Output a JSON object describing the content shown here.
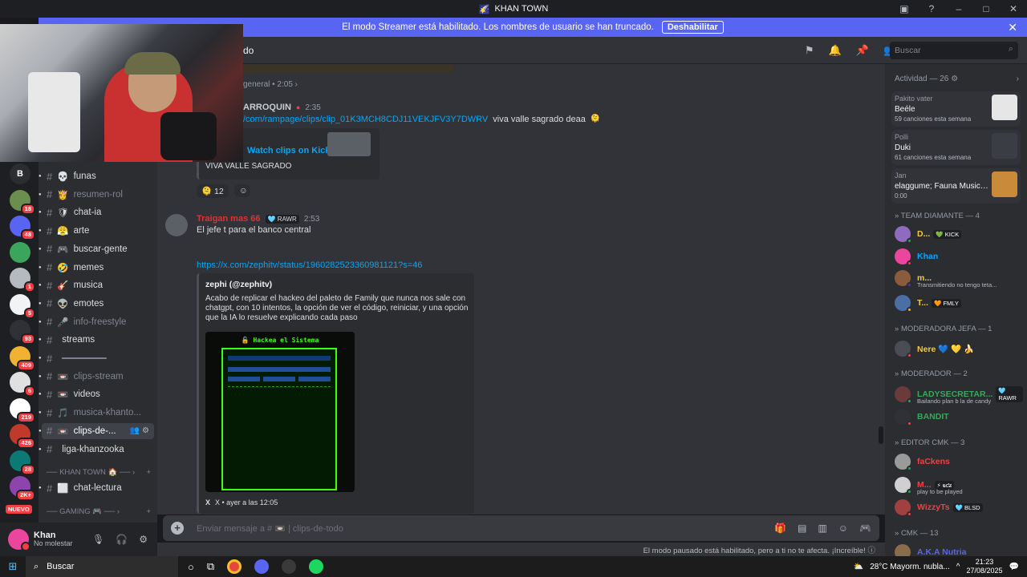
{
  "window": {
    "title": "KHAN TOWN"
  },
  "banner": {
    "text": "El modo Streamer está habilitado. Los nombres de usuario se han truncado.",
    "button": "Deshabilitar"
  },
  "header": {
    "channel_title": "do",
    "search_placeholder": "Buscar"
  },
  "servers": [
    {
      "label": "B",
      "badge": ""
    },
    {
      "label": "",
      "badge": "18"
    },
    {
      "label": "",
      "badge": "48"
    },
    {
      "label": "",
      "badge": ""
    },
    {
      "label": "",
      "badge": "1"
    },
    {
      "label": "",
      "badge": "5"
    },
    {
      "label": "",
      "badge": "93"
    },
    {
      "label": "",
      "badge": "409"
    },
    {
      "label": "",
      "badge": "6"
    },
    {
      "label": "",
      "badge": "219"
    },
    {
      "label": "",
      "badge": "426"
    },
    {
      "label": "",
      "badge": "28"
    },
    {
      "label": "",
      "badge": "2K+"
    }
  ],
  "servers_new_label": "NUEVO",
  "channels": [
    {
      "icon": "💀",
      "name": "funas",
      "muted": false
    },
    {
      "icon": "👸",
      "name": "resumen-rol",
      "muted": true
    },
    {
      "icon": "🛡",
      "name": "chat-ia",
      "muted": false
    },
    {
      "icon": "😤",
      "name": "arte",
      "muted": false
    },
    {
      "icon": "🎮",
      "name": "buscar-gente",
      "muted": false
    },
    {
      "icon": "🤣",
      "name": "memes",
      "muted": false
    },
    {
      "icon": "🎸",
      "name": "musica",
      "muted": false
    },
    {
      "icon": "👽",
      "name": "emotes",
      "muted": false
    },
    {
      "icon": "🎤",
      "name": "info-freestyle",
      "muted": true
    },
    {
      "icon": "",
      "name": "streams",
      "muted": false
    },
    {
      "icon": "",
      "name": "━━━━━━━━",
      "muted": true
    },
    {
      "icon": "📼",
      "name": "clips-stream",
      "muted": true
    },
    {
      "icon": "📼",
      "name": "videos",
      "muted": false
    },
    {
      "icon": "🎵",
      "name": "musica-khanto...",
      "muted": true
    },
    {
      "icon": "📼",
      "name": "clips-de-...",
      "muted": false
    },
    {
      "icon": "",
      "name": "liga-khanzooka",
      "muted": false
    }
  ],
  "categories": [
    {
      "name": "── KHAN TOWN 🏠 ── ›"
    },
    {
      "name": "── GAMING 🎮 ── ›"
    }
  ],
  "channel_after_cat": {
    "icon": "⬜",
    "name": "chat-lectura"
  },
  "user": {
    "name": "Khan",
    "status": "No molestar"
  },
  "messages": {
    "reply_context": "general • 2:05 ›",
    "m1_author": "ARROQUIN",
    "m1_time": "2:35",
    "m1_link": "/com/rampage/clips/clip_01K3MCH8CDJ11VEKJFV3Y7DWRV",
    "m1_text": "viva valle sagrado deaa",
    "m1_embed_title": "Watch clips on Kick",
    "m1_embed_text": "VIVA VALLE SAGRADO",
    "m1_reaction_count": "12",
    "m2_author": "Traigan mas 66",
    "m2_tag": "RAWR",
    "m2_time": "2:53",
    "m2_text": "El jefe t para el banco central",
    "m2_link": "https://x.com/zephitv/status/1960282523360981121?s=46",
    "embed_author": "zephi (@zephitv)",
    "embed_text": "Acabo de replicar el hackeo del paleto de Family que nunca nos sale con chatgpt, con 10 intentos, la opción de ver el código, reiniciar, y una opción que la IA lo resuelve explicando cada paso",
    "embed_image_title": "🔓 Hackea el Sistema",
    "embed_footer": "X • ayer a las 12:05"
  },
  "input_placeholder": "Enviar mensaje a # 📼 | clips-de-todo",
  "status_line": "El modo pausado está habilitado, pero a ti no te afecta. ¡Increíble!",
  "activity": {
    "header": "Actividad — 26",
    "items": [
      {
        "who": "Pakito vater",
        "what": "Beéle",
        "sub": "59 canciones esta semana",
        "thumb": "#e6e6e6"
      },
      {
        "who": "Polli",
        "what": "Duki",
        "sub": "61 canciones esta semana",
        "thumb": "#3b3d44"
      },
      {
        "who": "Jan",
        "what": "elaggume; Fauna Music; Co...",
        "sub": "0:00",
        "thumb": "#c98a3a"
      }
    ]
  },
  "member_groups": [
    {
      "header": "TEAM DIAMANTE — 4",
      "members": [
        {
          "name": "D...",
          "color": "#f2c94c",
          "tag": "💚 KICK",
          "sub": "",
          "av": "#8e6bbf",
          "st": "#23a55a"
        },
        {
          "name": "Khan",
          "color": "#00a8fc",
          "tag": "",
          "sub": "",
          "av": "#eb459e",
          "st": "#f23f43"
        },
        {
          "name": "m...",
          "color": "#f2c94c",
          "tag": "",
          "sub": "Transmitiendo no tengo teta...",
          "av": "#8a5b3c",
          "st": "#593695"
        },
        {
          "name": "T...",
          "color": "#f2c94c",
          "tag": "🧡 FMLY",
          "sub": "",
          "av": "#4a6fa5",
          "st": "#f0b232"
        }
      ]
    },
    {
      "header": "MODERADORA JEFA — 1",
      "members": [
        {
          "name": "Nere 💙 💛 🍌",
          "color": "#f2c94c",
          "tag": "",
          "sub": "",
          "av": "#4a4d55",
          "st": "#f23f43"
        }
      ]
    },
    {
      "header": "MODERADOR — 2",
      "members": [
        {
          "name": "LADYSECRETAR...",
          "color": "#3ba55c",
          "tag": "🩵 RAWR",
          "sub": "Bailando plan b la de candy",
          "av": "#6b3a3a",
          "st": "#23a55a"
        },
        {
          "name": "BANDIT",
          "color": "#3ba55c",
          "tag": "",
          "sub": "",
          "av": "#2f3136",
          "st": "#f23f43"
        }
      ]
    },
    {
      "header": "EDITOR CMK — 3",
      "members": [
        {
          "name": "faCkens",
          "color": "#ed4245",
          "tag": "",
          "sub": "",
          "av": "#9a9a9a",
          "st": "#23a55a"
        },
        {
          "name": "M...",
          "color": "#ed4245",
          "tag": "⚡ ҩƈƶ",
          "sub": "play to be played",
          "av": "#d0d0d0",
          "st": "#23a55a"
        },
        {
          "name": "WizzyTs",
          "color": "#ed4245",
          "tag": "🩵 BLSD",
          "sub": "",
          "av": "#a04040",
          "st": "#f23f43"
        }
      ]
    },
    {
      "header": "CMK — 13",
      "members": [
        {
          "name": "A.K.A Nutria",
          "color": "#5865f2",
          "tag": "",
          "sub": "",
          "av": "#8a6b4a",
          "st": "#23a55a"
        }
      ]
    }
  ],
  "taskbar": {
    "search": "Buscar",
    "weather": "28°C  Mayorm. nubla...",
    "time": "21:23",
    "date": "27/08/2025"
  }
}
